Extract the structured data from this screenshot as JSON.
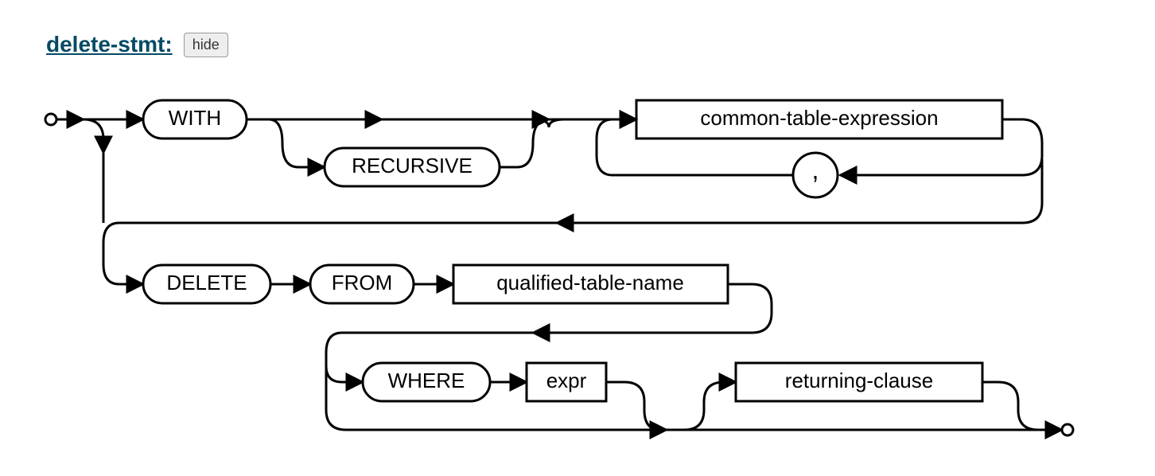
{
  "header": {
    "title": "delete-stmt:",
    "button": "hide"
  },
  "nodes": {
    "with": "WITH",
    "recursive": "RECURSIVE",
    "cte": "common-table-expression",
    "comma": ",",
    "delete": "DELETE",
    "from": "FROM",
    "qtn": "qualified-table-name",
    "where": "WHERE",
    "expr": "expr",
    "returning": "returning-clause"
  }
}
